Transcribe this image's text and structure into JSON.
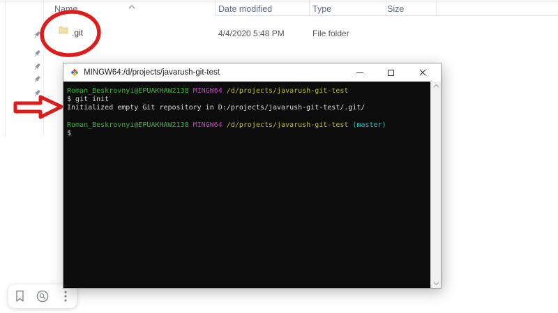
{
  "explorer": {
    "columns": {
      "name": "Name",
      "date": "Date modified",
      "type": "Type",
      "size": "Size"
    },
    "row": {
      "name": ".git",
      "date": "4/4/2020 5:48 PM",
      "type": "File folder",
      "size": ""
    },
    "nav_pin_count": 5
  },
  "terminal": {
    "title": "MINGW64:/d/projects/javarush-git-test",
    "palette": {
      "green": "#30bd30",
      "magenta": "#c43fc4",
      "yellow": "#bfbf22",
      "cyan": "#2fbfbf",
      "default": "#d8d8d8",
      "background": "#0c0c0c"
    },
    "lines": [
      {
        "segments": [
          {
            "t": "Roman_Beskrovnyi@EPUAKHAW2138",
            "c": "green"
          },
          {
            "t": " MINGW64",
            "c": "magenta"
          },
          {
            "t": " /d/projects/javarush-git-test",
            "c": "yellow"
          }
        ]
      },
      {
        "segments": [
          {
            "t": "$ git init",
            "c": "default"
          }
        ]
      },
      {
        "segments": [
          {
            "t": "Initialized empty Git repository in D:/projects/javarush-git-test/.git/",
            "c": "default"
          }
        ]
      },
      {
        "segments": []
      },
      {
        "segments": [
          {
            "t": "Roman_Beskrovnyi@EPUAKHAW2138",
            "c": "green"
          },
          {
            "t": " MINGW64",
            "c": "magenta"
          },
          {
            "t": " /d/projects/javarush-git-test",
            "c": "yellow"
          },
          {
            "t": " (master)",
            "c": "cyan"
          }
        ]
      },
      {
        "segments": [
          {
            "t": "$",
            "c": "default"
          }
        ]
      }
    ]
  },
  "annotations": {
    "color": "#de1c1c",
    "shapes": [
      "ellipse-around-git-folder",
      "arrow-pointing-to-terminal"
    ]
  },
  "viewer_toolbar": {
    "icons": [
      "bookmark-icon",
      "lens-search-icon",
      "more-options-icon"
    ]
  }
}
